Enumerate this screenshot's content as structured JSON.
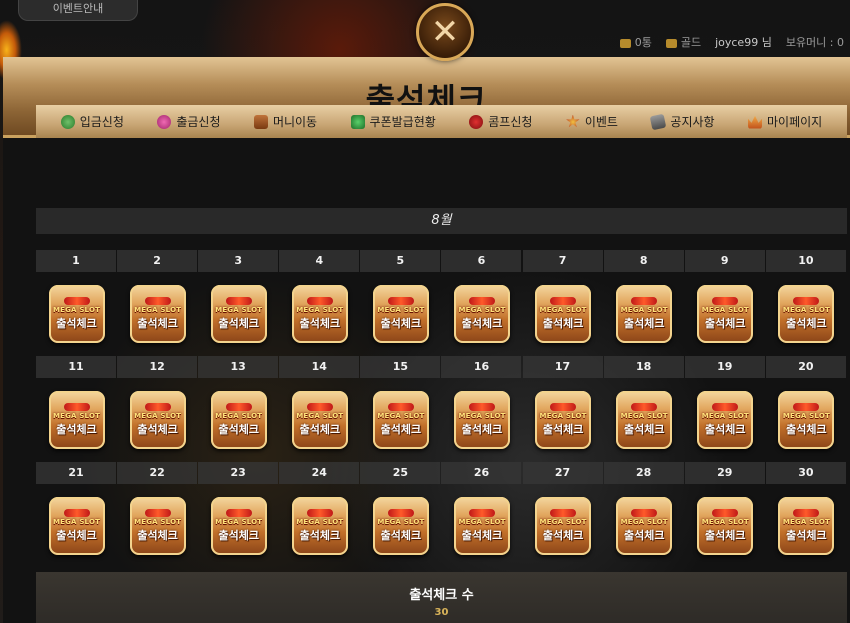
{
  "background": {
    "event_tab": "이벤트안내",
    "top_right": {
      "mail": "0통",
      "level": "골드",
      "username": "joyce99",
      "suffix": "님",
      "balance_label": "보유머니 : 0"
    }
  },
  "modal": {
    "title": "출석체크",
    "close_icon": "close-x-icon"
  },
  "nav": [
    {
      "label": "입금신청",
      "icon": "money-bag-icon"
    },
    {
      "label": "출금신청",
      "icon": "donut-icon"
    },
    {
      "label": "머니이동",
      "icon": "chest-icon"
    },
    {
      "label": "쿠폰발급현황",
      "icon": "clover-icon"
    },
    {
      "label": "콤프신청",
      "icon": "cherry-icon"
    },
    {
      "label": "이벤트",
      "icon": "star-icon"
    },
    {
      "label": "공지사항",
      "icon": "notice-icon"
    },
    {
      "label": "마이페이지",
      "icon": "crown-icon"
    }
  ],
  "calendar": {
    "month": "8월",
    "stamp_logo": "MEGA SLOT",
    "stamp_label": "출석체크",
    "weeks": [
      [
        "1",
        "2",
        "3",
        "4",
        "5",
        "6",
        "7",
        "8",
        "9",
        "10"
      ],
      [
        "11",
        "12",
        "13",
        "14",
        "15",
        "16",
        "17",
        "18",
        "19",
        "20"
      ],
      [
        "21",
        "22",
        "23",
        "24",
        "25",
        "26",
        "27",
        "28",
        "29",
        "30"
      ]
    ]
  },
  "summary": {
    "title": "출석체크 수",
    "count": "30"
  },
  "colors": {
    "header_gold": "#b58d58",
    "nav_tan": "#c8a574",
    "count_gold": "#d9b45a",
    "close_border": "#d9a857"
  }
}
